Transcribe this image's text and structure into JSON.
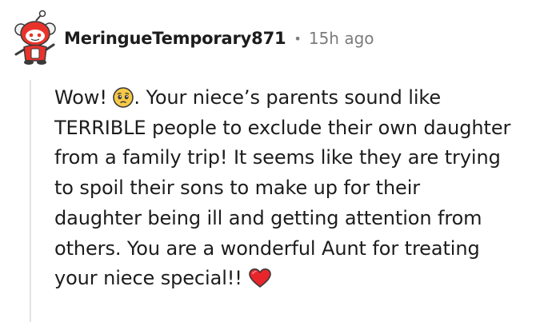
{
  "comment": {
    "author": "MeringueTemporary871",
    "separator": "•",
    "time": "15h ago",
    "lines": {
      "l1_a": "Wow!",
      "l1_b": ". Your niece’s parents sound like",
      "l2": "TERRIBLE people to exclude their own daughter",
      "l3": "from a family trip! It seems like they are trying",
      "l4": "to spoil their sons to make up for their",
      "l5": "daughter being ill and getting attention from",
      "l6": "others. You are a wonderful Aunt for treating",
      "l7": "your niece special!!"
    },
    "icons": [
      "snoo-avatar",
      "pleading-face-emoji",
      "red-heart-emoji"
    ]
  }
}
